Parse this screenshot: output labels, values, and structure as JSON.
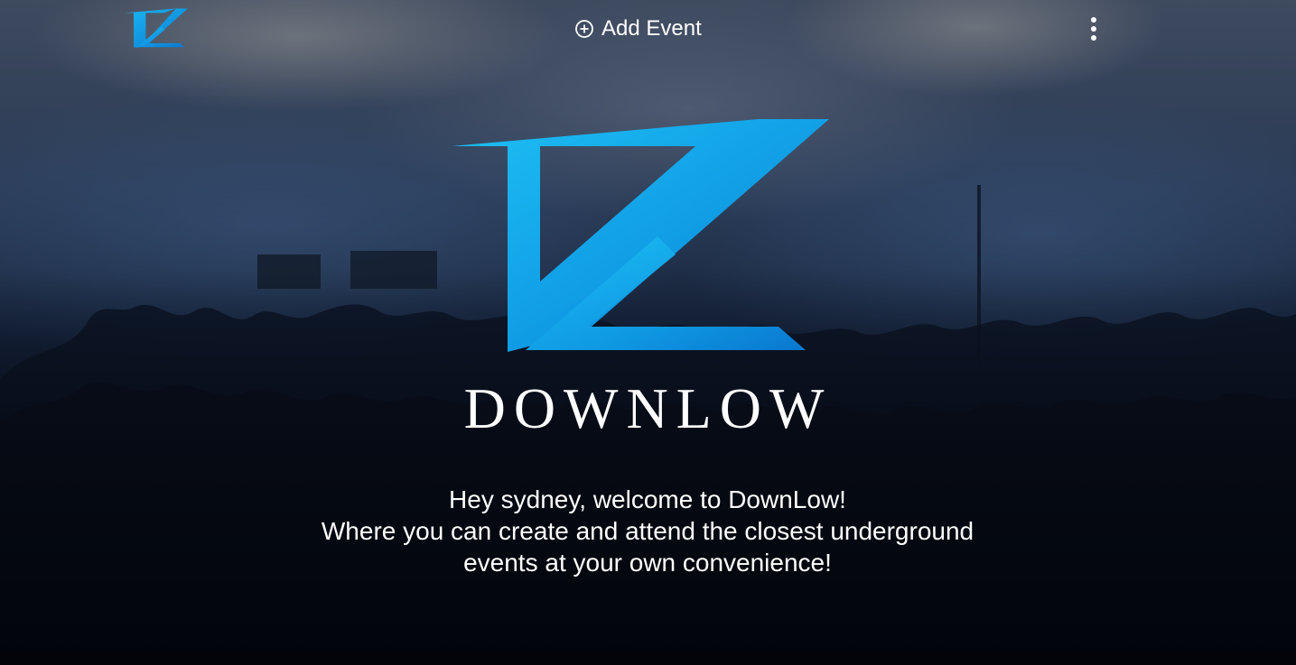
{
  "nav": {
    "logo_icon": "downlow-logo-icon",
    "add_event_icon": "plus-circle-icon",
    "add_event_label": "Add Event",
    "menu_icon": "more-vertical-icon"
  },
  "hero": {
    "logo_icon": "downlow-logo-icon",
    "brand_name": "DOWNLOW",
    "welcome_lines": [
      "Hey sydney, welcome to DownLow!",
      "Where you can create and attend the closest underground",
      "events at your own convenience!"
    ]
  },
  "colors": {
    "brand_light": "#1ab8f2",
    "brand_dark": "#0a78d0",
    "text": "#ffffff"
  }
}
